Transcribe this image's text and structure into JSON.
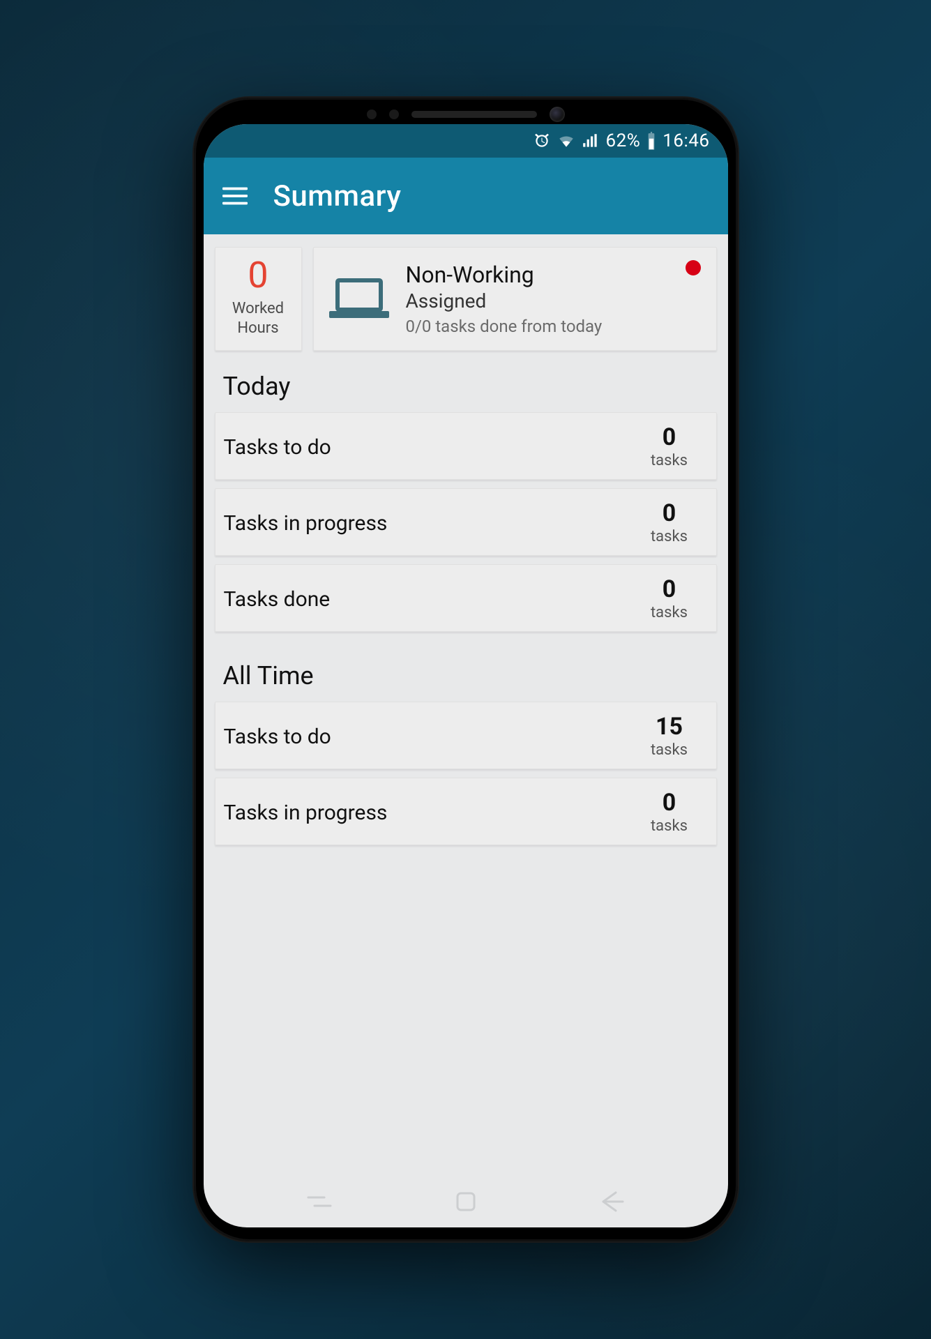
{
  "status_bar": {
    "battery_pct": "62%",
    "time": "16:46"
  },
  "app_bar": {
    "title": "Summary"
  },
  "worked_hours": {
    "value": "0",
    "label_line1": "Worked",
    "label_line2": "Hours"
  },
  "status_card": {
    "title": "Non-Working",
    "subtitle": "Assigned",
    "detail": "0/0 tasks done from today",
    "indicator_color": "#d70015"
  },
  "sections": {
    "today": {
      "header": "Today",
      "rows": [
        {
          "label": "Tasks to do",
          "value": "0",
          "unit": "tasks"
        },
        {
          "label": "Tasks in progress",
          "value": "0",
          "unit": "tasks"
        },
        {
          "label": "Tasks done",
          "value": "0",
          "unit": "tasks"
        }
      ]
    },
    "all_time": {
      "header": "All Time",
      "rows": [
        {
          "label": "Tasks to do",
          "value": "15",
          "unit": "tasks"
        },
        {
          "label": "Tasks in progress",
          "value": "0",
          "unit": "tasks"
        }
      ]
    }
  },
  "colors": {
    "accent": "#1583a6",
    "accent_dark": "#0e5a73",
    "worked_number": "#e44332"
  }
}
